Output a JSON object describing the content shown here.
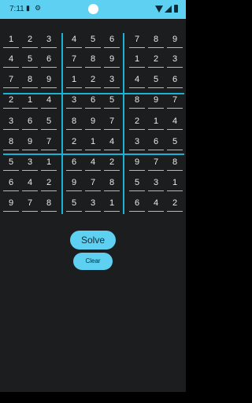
{
  "status_bar": {
    "time": "7:11",
    "icons": [
      "sim-card-icon",
      "settings-icon",
      "camera-icon",
      "wifi-icon",
      "signal-icon",
      "battery-icon"
    ],
    "background": "#5ed0f2"
  },
  "sudoku": {
    "grid_line_color": "#1ab3d6",
    "rows": [
      [
        "1",
        "2",
        "3",
        "4",
        "5",
        "6",
        "7",
        "8",
        "9"
      ],
      [
        "4",
        "5",
        "6",
        "7",
        "8",
        "9",
        "1",
        "2",
        "3"
      ],
      [
        "7",
        "8",
        "9",
        "1",
        "2",
        "3",
        "4",
        "5",
        "6"
      ],
      [
        "2",
        "1",
        "4",
        "3",
        "6",
        "5",
        "8",
        "9",
        "7"
      ],
      [
        "3",
        "6",
        "5",
        "8",
        "9",
        "7",
        "2",
        "1",
        "4"
      ],
      [
        "8",
        "9",
        "7",
        "2",
        "1",
        "4",
        "3",
        "6",
        "5"
      ],
      [
        "5",
        "3",
        "1",
        "6",
        "4",
        "2",
        "9",
        "7",
        "8"
      ],
      [
        "6",
        "4",
        "2",
        "9",
        "7",
        "8",
        "5",
        "3",
        "1"
      ],
      [
        "9",
        "7",
        "8",
        "5",
        "3",
        "1",
        "6",
        "4",
        "2"
      ]
    ]
  },
  "actions": {
    "solve_label": "Solve",
    "clear_label": "Clear",
    "button_color": "#5ed0f2"
  }
}
